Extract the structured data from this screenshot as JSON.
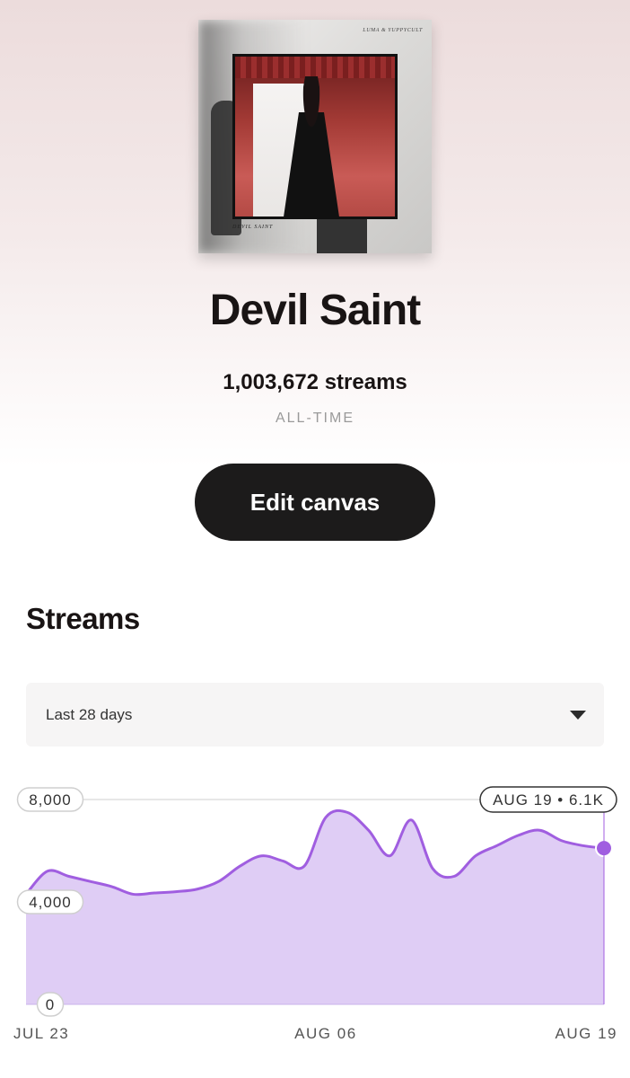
{
  "album_art": {
    "top_text": "LUMA & YUPPYCULT",
    "bottom_text": "DEVIL SAINT"
  },
  "song": {
    "title": "Devil Saint",
    "streams": "1,003,672 streams",
    "period": "ALL-TIME"
  },
  "edit_button": {
    "label": "Edit canvas"
  },
  "streams_section": {
    "title": "Streams",
    "range_select": {
      "selected": "Last 28 days"
    }
  },
  "colors": {
    "accent": "#a05ee0",
    "fill": "#dfcdf5",
    "button": "#1c1b1b"
  },
  "chart_data": {
    "type": "area",
    "x": [
      "JUL 23",
      "JUL 24",
      "JUL 25",
      "JUL 26",
      "JUL 27",
      "JUL 28",
      "JUL 29",
      "JUL 30",
      "JUL 31",
      "AUG 01",
      "AUG 02",
      "AUG 03",
      "AUG 04",
      "AUG 05",
      "AUG 06",
      "AUG 07",
      "AUG 08",
      "AUG 09",
      "AUG 10",
      "AUG 11",
      "AUG 12",
      "AUG 13",
      "AUG 14",
      "AUG 15",
      "AUG 16",
      "AUG 17",
      "AUG 18",
      "AUG 19"
    ],
    "values": [
      4300,
      5200,
      5000,
      4800,
      4600,
      4300,
      4350,
      4400,
      4500,
      4800,
      5400,
      5800,
      5600,
      5400,
      7300,
      7500,
      6800,
      5800,
      7200,
      5300,
      5000,
      5800,
      6200,
      6600,
      6800,
      6400,
      6200,
      6100
    ],
    "x_tick_labels": [
      "JUL 23",
      "AUG 06",
      "AUG 19"
    ],
    "y_tick_labels": [
      "8,000",
      "4,000",
      "0"
    ],
    "y_ticks": [
      8000,
      4000,
      0
    ],
    "ylim": [
      0,
      8000
    ],
    "tooltip": "AUG 19 • 6.1K",
    "grid": true
  }
}
